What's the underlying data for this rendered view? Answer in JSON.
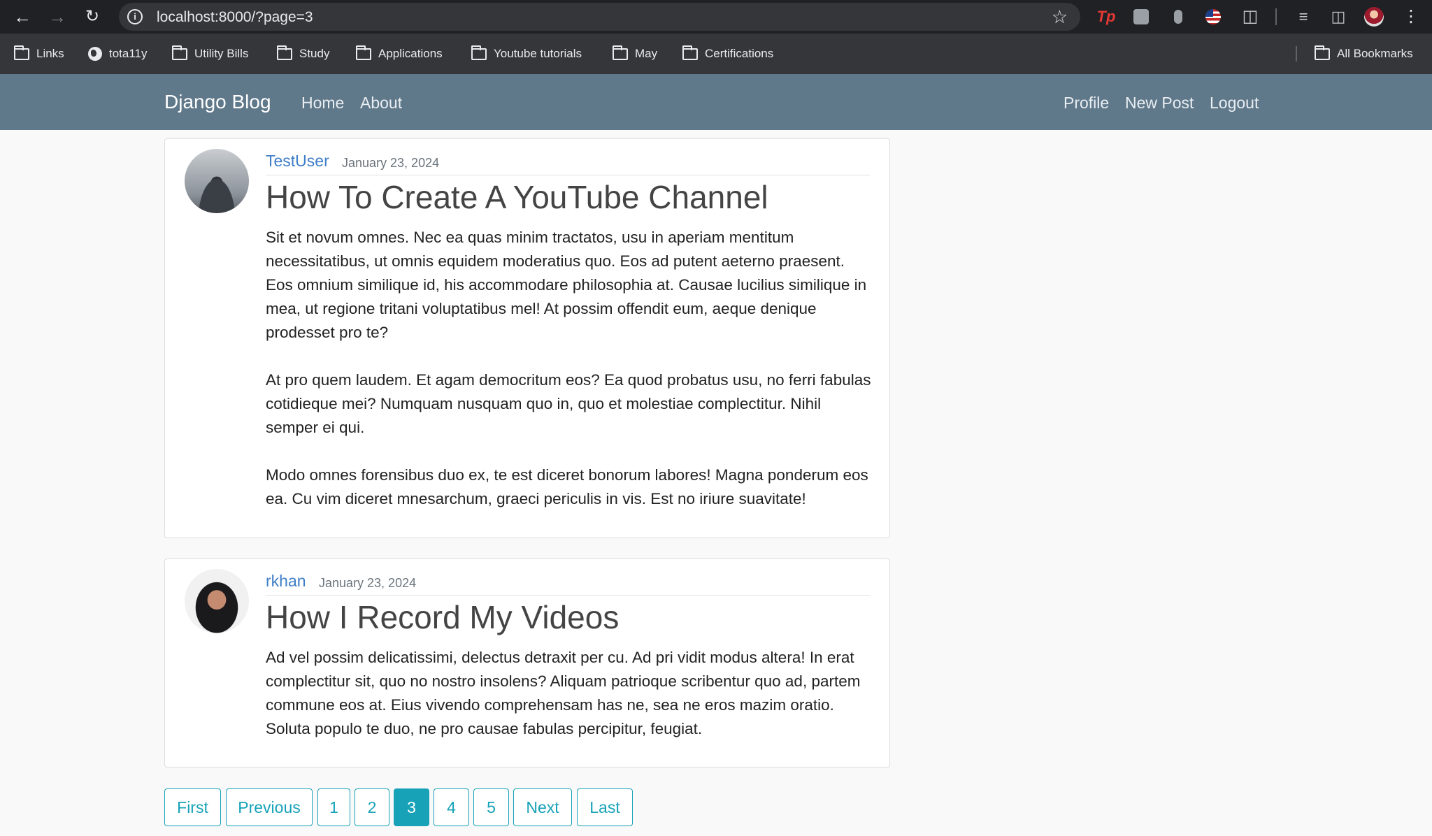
{
  "browser": {
    "url": "localhost:8000/?page=3",
    "bookmarks": [
      "Links",
      "tota11y",
      "Utility Bills",
      "Study",
      "Applications",
      "Youtube tutorials",
      "May",
      "Certifications"
    ],
    "all_bookmarks": "All Bookmarks",
    "extension_tp": "Tp"
  },
  "site": {
    "brand": "Django Blog",
    "nav_left": [
      "Home",
      "About"
    ],
    "nav_right": [
      "Profile",
      "New Post",
      "Logout"
    ]
  },
  "posts": [
    {
      "author": "TestUser",
      "date": "January 23, 2024",
      "title": "How To Create A YouTube Channel",
      "paragraphs": [
        "Sit et novum omnes. Nec ea quas minim tractatos, usu in aperiam mentitum necessitatibus, ut omnis equidem moderatius quo. Eos ad putent aeterno praesent. Eos omnium similique id, his accommodare philosophia at. Causae lucilius similique in mea, ut regione tritani voluptatibus mel! At possim offendit eum, aeque denique prodesset pro te?",
        "At pro quem laudem. Et agam democritum eos? Ea quod probatus usu, no ferri fabulas cotidieque mei? Numquam nusquam quo in, quo et molestiae complectitur. Nihil semper ei qui.",
        "Modo omnes forensibus duo ex, te est diceret bonorum labores! Magna ponderum eos ea. Cu vim diceret mnesarchum, graeci periculis in vis. Est no iriure suavitate!"
      ]
    },
    {
      "author": "rkhan",
      "date": "January 23, 2024",
      "title": "How I Record My Videos",
      "paragraphs": [
        "Ad vel possim delicatissimi, delectus detraxit per cu. Ad pri vidit modus altera! In erat complectitur sit, quo no nostro insolens? Aliquam patrioque scribentur quo ad, partem commune eos at. Eius vivendo comprehensam has ne, sea ne eros mazim oratio. Soluta populo te duo, ne pro causae fabulas percipitur, feugiat."
      ]
    }
  ],
  "pagination": {
    "items": [
      "First",
      "Previous",
      "1",
      "2",
      "3",
      "4",
      "5",
      "Next",
      "Last"
    ],
    "current": "3"
  }
}
